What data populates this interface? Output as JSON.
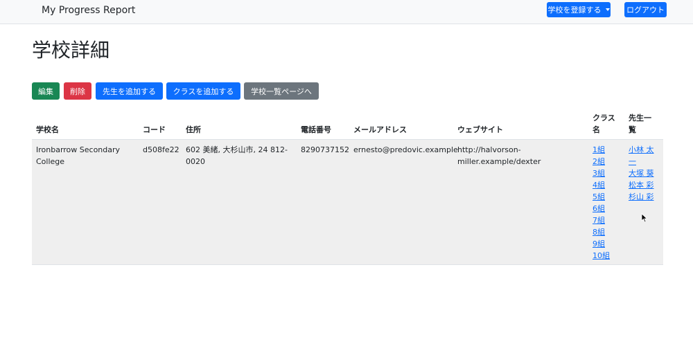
{
  "navbar": {
    "brand": "My Progress Report",
    "register_school": "学校を登録する",
    "logout": "ログアウト"
  },
  "page": {
    "title": "学校詳細"
  },
  "actions": {
    "edit": "編集",
    "delete": "削除",
    "add_teacher": "先生を追加する",
    "add_class": "クラスを追加する",
    "school_list": "学校一覧ページへ"
  },
  "table": {
    "headers": {
      "name": "学校名",
      "code": "コード",
      "address": "住所",
      "phone": "電話番号",
      "email": "メールアドレス",
      "website": "ウェブサイト",
      "class_name_1": "クラス",
      "class_name_2": "名",
      "teachers_1": "先生一",
      "teachers_2": "覧"
    },
    "row": {
      "name_1": "Ironbarrow Secondary",
      "name_2": "College",
      "code": "d508fe22",
      "address_1": "602 美緒, 大杉山市, 24 812-",
      "address_2": "0020",
      "phone": "8290737152",
      "email": "ernesto@predovic.example",
      "website_1": "http://halvorson-",
      "website_2": "miller.example/dexter",
      "classes": [
        "1組",
        "2組",
        "3組",
        "4組",
        "5組",
        "6組",
        "7組",
        "8組",
        "9組",
        "10組"
      ],
      "teachers": [
        "小林 太",
        "一",
        "大塚 葵",
        "松本 彩",
        "杉山 彩"
      ]
    }
  },
  "colors": {
    "primary": "#0d6efd",
    "success": "#198754",
    "danger": "#dc3545",
    "secondary": "#6c757d"
  }
}
